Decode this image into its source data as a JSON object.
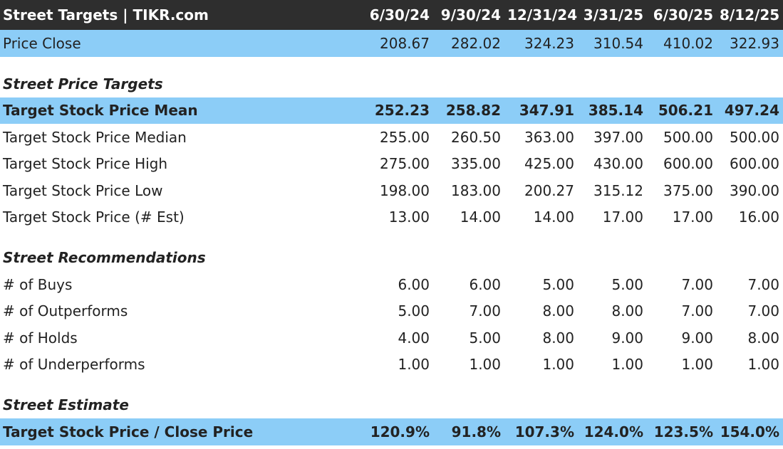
{
  "header": {
    "title": "Street Targets | TIKR.com",
    "columns": [
      "6/30/24",
      "9/30/24",
      "12/31/24",
      "3/31/25",
      "6/30/25",
      "8/12/25"
    ]
  },
  "colors": {
    "header_bg": "#2e2e2e",
    "header_text": "#ffffff",
    "highlight_row": "#8ccdf7"
  },
  "price_close": {
    "label": "Price Close",
    "values": [
      "208.67",
      "282.02",
      "324.23",
      "310.54",
      "410.02",
      "322.93"
    ]
  },
  "street_price_targets": {
    "title": "Street Price Targets",
    "rows": [
      {
        "label": "Target Stock Price Mean",
        "values": [
          "252.23",
          "258.82",
          "347.91",
          "385.14",
          "506.21",
          "497.24"
        ]
      },
      {
        "label": "Target Stock Price Median",
        "values": [
          "255.00",
          "260.50",
          "363.00",
          "397.00",
          "500.00",
          "500.00"
        ]
      },
      {
        "label": "Target Stock Price High",
        "values": [
          "275.00",
          "335.00",
          "425.00",
          "430.00",
          "600.00",
          "600.00"
        ]
      },
      {
        "label": "Target Stock Price Low",
        "values": [
          "198.00",
          "183.00",
          "200.27",
          "315.12",
          "375.00",
          "390.00"
        ]
      },
      {
        "label": "Target Stock Price (# Est)",
        "values": [
          "13.00",
          "14.00",
          "14.00",
          "17.00",
          "17.00",
          "16.00"
        ]
      }
    ]
  },
  "street_recommendations": {
    "title": "Street Recommendations",
    "rows": [
      {
        "label": "# of Buys",
        "values": [
          "6.00",
          "6.00",
          "5.00",
          "5.00",
          "7.00",
          "7.00"
        ]
      },
      {
        "label": "# of Outperforms",
        "values": [
          "5.00",
          "7.00",
          "8.00",
          "8.00",
          "7.00",
          "7.00"
        ]
      },
      {
        "label": "# of Holds",
        "values": [
          "4.00",
          "5.00",
          "8.00",
          "9.00",
          "9.00",
          "8.00"
        ]
      },
      {
        "label": "# of Underperforms",
        "values": [
          "1.00",
          "1.00",
          "1.00",
          "1.00",
          "1.00",
          "1.00"
        ]
      }
    ]
  },
  "street_estimate": {
    "title": "Street Estimate",
    "rows": [
      {
        "label": "Target Stock Price / Close Price",
        "values": [
          "120.9%",
          "91.8%",
          "107.3%",
          "124.0%",
          "123.5%",
          "154.0%"
        ]
      }
    ]
  }
}
